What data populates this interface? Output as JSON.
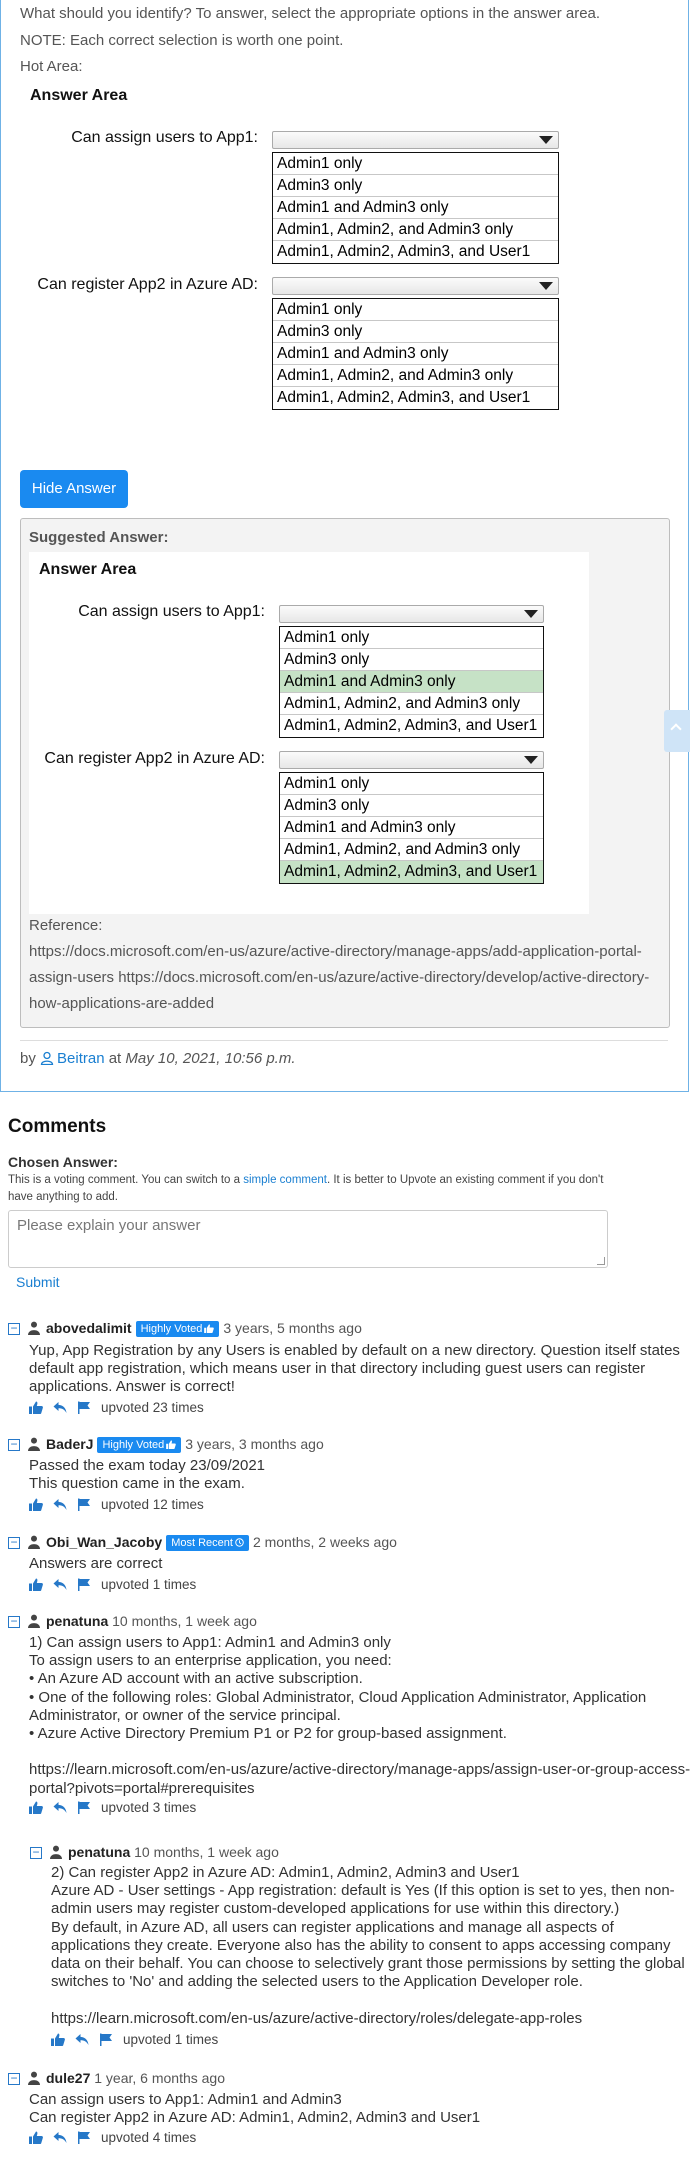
{
  "question": {
    "prompt": "What should you identify? To answer, select the appropriate options in the answer area.",
    "note": "NOTE: Each correct selection is worth one point.",
    "hot_area": "Hot Area:",
    "answer_area_title": "Answer Area",
    "dropdowns": [
      {
        "label": "Can assign users to App1:",
        "options": [
          "Admin1 only",
          "Admin3 only",
          "Admin1 and Admin3 only",
          "Admin1, Admin2, and Admin3 only",
          "Admin1, Admin2, Admin3, and User1"
        ]
      },
      {
        "label": "Can register App2 in Azure AD:",
        "options": [
          "Admin1 only",
          "Admin3 only",
          "Admin1 and Admin3 only",
          "Admin1, Admin2, and Admin3 only",
          "Admin1, Admin2, Admin3, and User1"
        ]
      }
    ],
    "hide_answer_button": "Hide Answer"
  },
  "suggested": {
    "title": "Suggested Answer:",
    "answer_area_title": "Answer Area",
    "dropdowns": [
      {
        "label": "Can assign users to App1:",
        "options": [
          "Admin1 only",
          "Admin3 only",
          "Admin1 and Admin3 only",
          "Admin1, Admin2, and Admin3 only",
          "Admin1, Admin2, Admin3, and User1"
        ],
        "selected": "Admin1 and Admin3 only"
      },
      {
        "label": "Can register App2 in Azure AD:",
        "options": [
          "Admin1 only",
          "Admin3 only",
          "Admin1 and Admin3 only",
          "Admin1, Admin2, and Admin3 only",
          "Admin1, Admin2, Admin3, and User1"
        ],
        "selected": "Admin1, Admin2, Admin3, and User1"
      }
    ],
    "highlight_color": "#c6e2c6",
    "reference_label": "Reference:",
    "reference_lines": [
      "https://docs.microsoft.com/en-us/azure/active-directory/manage-apps/add-application-portal-",
      "assign-users https://docs.microsoft.com/en-us/azure/active-directory/develop/active-directory-",
      "how-applications-are-added"
    ]
  },
  "byline": {
    "by": "by",
    "user": "Beitran",
    "at": "at",
    "date": "May 10, 2021, 10:56 p.m."
  },
  "comments_section": {
    "title": "Comments",
    "chosen_answer_label": "Chosen Answer:",
    "voting_note_1": "This is a voting comment. You can switch to a",
    "voting_note_link": "simple comment",
    "voting_note_2": ". It is better to Upvote an existing comment if you don't have anything to add.",
    "textarea_placeholder": "Please explain your answer",
    "submit_label": "Submit"
  },
  "comments": [
    {
      "user": "abovedalimit",
      "badge": "Highly Voted",
      "age": "3 years, 5 months ago",
      "lines": [
        "Yup, App Registration by any Users is enabled by default on a new directory. Question itself states",
        "default app registration, which means user in that directory including guest users can register",
        "applications. Answer is correct!"
      ],
      "upvotes": "upvoted 23 times"
    },
    {
      "user": "BaderJ",
      "badge": "Highly Voted",
      "age": "3 years, 3 months ago",
      "lines": [
        "Passed the exam today 23/09/2021",
        "This question came in the exam."
      ],
      "upvotes": "upvoted 12 times"
    },
    {
      "user": "Obi_Wan_Jacoby",
      "badge": "Most Recent",
      "age": "2 months, 2 weeks ago",
      "lines": [
        "Answers are correct"
      ],
      "upvotes": "upvoted 1 times"
    },
    {
      "user": "penatuna",
      "badge": "",
      "age": "10 months, 1 week ago",
      "lines": [
        "1) Can assign users to App1: Admin1 and Admin3 only",
        "To assign users to an enterprise application, you need:",
        "• An Azure AD account with an active subscription.",
        "• One of the following roles: Global Administrator, Cloud Application Administrator, Application",
        "Administrator, or owner of the service principal.",
        "• Azure Active Directory Premium P1 or P2 for group-based assignment.",
        "",
        "https://learn.microsoft.com/en-us/azure/active-directory/manage-apps/assign-user-or-group-access-",
        "portal?pivots=portal#prerequisites"
      ],
      "upvotes": "upvoted 3 times"
    },
    {
      "user": "penatuna",
      "badge": "",
      "age": "10 months, 1 week ago",
      "lines": [
        "2) Can register App2 in Azure AD: Admin1, Admin2, Admin3 and User1",
        "Azure AD - User settings - App registration: default is Yes (If this option is set to yes, then non-",
        "admin users may register custom-developed applications for use within this directory.)",
        "By default, in Azure AD, all users can register applications and manage all aspects of",
        "applications they create. Everyone also has the ability to consent to apps accessing company",
        "data on their behalf. You can choose to selectively grant those permissions by setting the global",
        "switches to 'No' and adding the selected users to the Application Developer role.",
        "",
        "https://learn.microsoft.com/en-us/azure/active-directory/roles/delegate-app-roles"
      ],
      "upvotes": "upvoted 1 times"
    },
    {
      "user": "dule27",
      "badge": "",
      "age": "1 year, 6 months ago",
      "lines": [
        "Can assign users to App1: Admin1 and Admin3",
        "Can register App2 in Azure AD: Admin1, Admin2, Admin3 and User1"
      ],
      "upvotes": "upvoted 4 times"
    }
  ]
}
